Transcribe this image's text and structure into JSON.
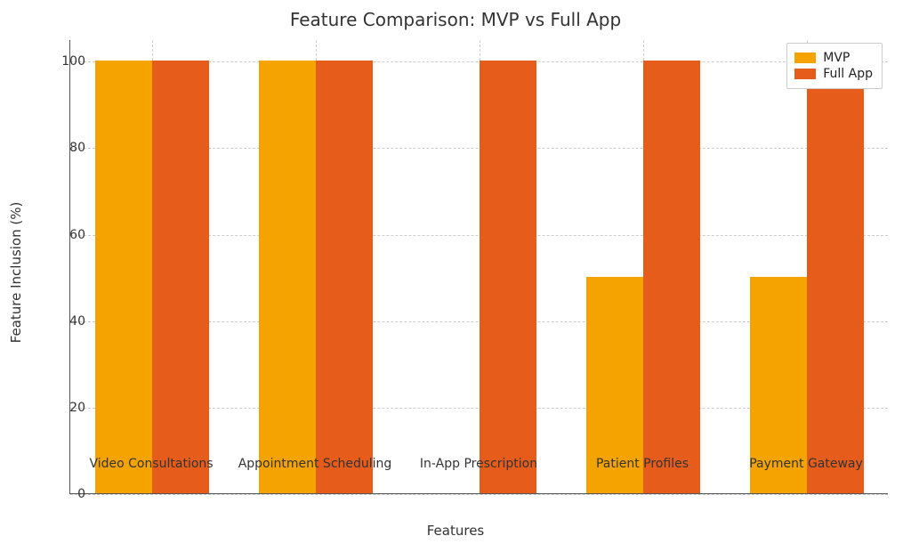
{
  "chart_data": {
    "type": "bar",
    "title": "Feature Comparison: MVP vs Full App",
    "xlabel": "Features",
    "ylabel": "Feature Inclusion (%)",
    "ylim": [
      0,
      105
    ],
    "yticks": [
      0,
      20,
      40,
      60,
      80,
      100
    ],
    "categories": [
      "Video Consultations",
      "Appointment Scheduling",
      "In-App Prescription",
      "Patient Profiles",
      "Payment Gateway"
    ],
    "series": [
      {
        "name": "MVP",
        "color": "#f4a300",
        "values": [
          100,
          100,
          0,
          50,
          50
        ]
      },
      {
        "name": "Full App",
        "color": "#e55c1b",
        "values": [
          100,
          100,
          100,
          100,
          100
        ]
      }
    ],
    "grid": true,
    "legend_position": "upper right"
  }
}
